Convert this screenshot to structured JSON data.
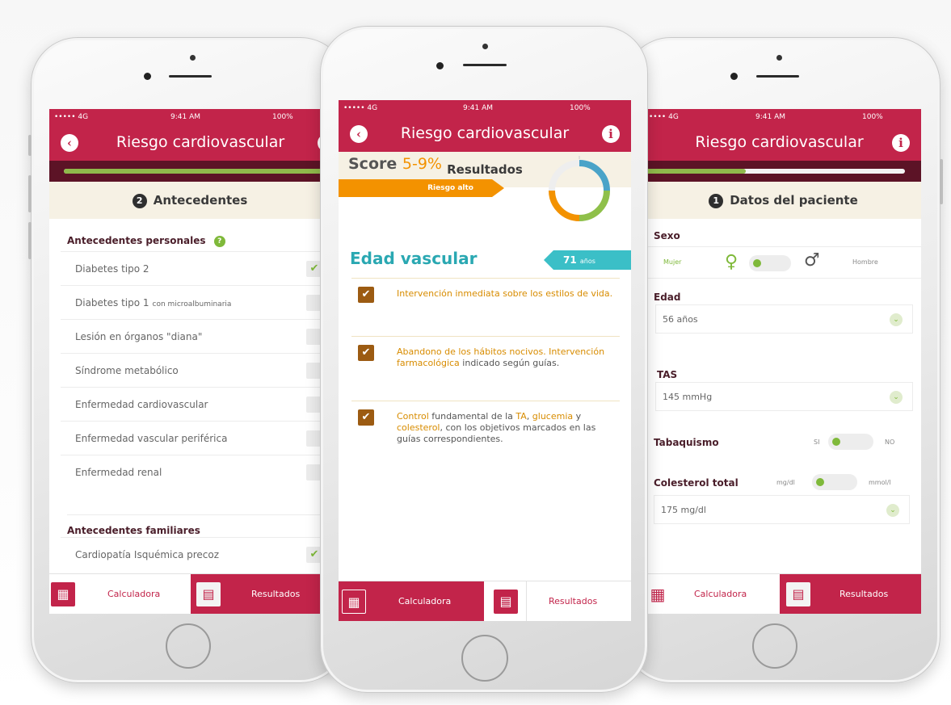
{
  "app": {
    "title": "Riesgo cardiovascular"
  },
  "status": {
    "carrier": "••••• 4G",
    "carrier_alt": "•••• 4G",
    "time": "9:41 AM",
    "battery": "100%"
  },
  "icons": {
    "back": "back-arrow-icon",
    "info": "info-icon",
    "calculator": "calculator-grid-icon",
    "results": "results-card-icon",
    "check": "checkmark-icon",
    "chevron": "chevron-down-icon",
    "female": "female-symbol-icon",
    "male": "male-symbol-icon"
  },
  "colors": {
    "brand": "#c2244a",
    "brand_dark": "#5c1326",
    "green": "#7fb93a",
    "orange": "#f39200",
    "teal": "#3bbfc7",
    "cream": "#f6f1e4"
  },
  "tabs": {
    "calculator": "Calculadora",
    "results": "Resultados"
  },
  "left": {
    "progress": 1.0,
    "section_step": "2",
    "section_title": "Antecedentes",
    "personal_header": "Antecedentes personales",
    "items": [
      {
        "label": "Diabetes tipo 2",
        "checked": true
      },
      {
        "label": "Diabetes tipo 1",
        "suffix": "con microalbuminaria",
        "checked": false
      },
      {
        "label": "Lesión en  órganos \"diana\"",
        "checked": false
      },
      {
        "label": "Síndrome metabólico",
        "checked": false
      },
      {
        "label": "Enfermedad cardiovascular",
        "checked": false
      },
      {
        "label": "Enfermedad vascular periférica",
        "checked": false
      },
      {
        "label": "Enfermedad renal",
        "checked": false
      }
    ],
    "family_header": "Antecedentes familiares",
    "family_items": [
      {
        "label": "Cardiopatía Isquémica precoz",
        "checked": true
      }
    ]
  },
  "center": {
    "section_title": "Resultados",
    "score_label": "Score",
    "score_value": "5-9%",
    "risk_label": "Riesgo alto",
    "edad_label": "Edad vascular",
    "edad_value": "71",
    "edad_unit": "años",
    "recs": [
      {
        "parts": [
          {
            "t": "Intervención inmediata sobre los estilos de vida.",
            "hl": true
          }
        ]
      },
      {
        "parts": [
          {
            "t": "Abandono de los hábitos nocivos. Intervención farmacológica",
            "hl": true
          },
          {
            "t": " indicado según guías.",
            "hl": false
          }
        ]
      },
      {
        "parts": [
          {
            "t": "Control",
            "hl": true
          },
          {
            "t": " fundamental de la ",
            "hl": false
          },
          {
            "t": "TA",
            "hl": true
          },
          {
            "t": ", ",
            "hl": false
          },
          {
            "t": "glucemia",
            "hl": true
          },
          {
            "t": " y ",
            "hl": false
          },
          {
            "t": "colesterol",
            "hl": true
          },
          {
            "t": ", con los objetivos marcados en las guías correspondientes.",
            "hl": false
          }
        ]
      }
    ]
  },
  "right": {
    "progress": 0.4,
    "section_step": "1",
    "section_title": "Datos del paciente",
    "sexo_label": "Sexo",
    "mujer": "Mujer",
    "hombre": "Hombre",
    "edad_label": "Edad",
    "edad_value": "56 años",
    "tas_label": "TAS",
    "tas_value": "145 mmHg",
    "tabaquismo_label": "Tabaquismo",
    "si": "SI",
    "no": "NO",
    "colesterol_label": "Colesterol total",
    "unit_mgdl": "mg/dl",
    "unit_mmol": "mmol/l",
    "colesterol_value": "175 mg/dl"
  }
}
